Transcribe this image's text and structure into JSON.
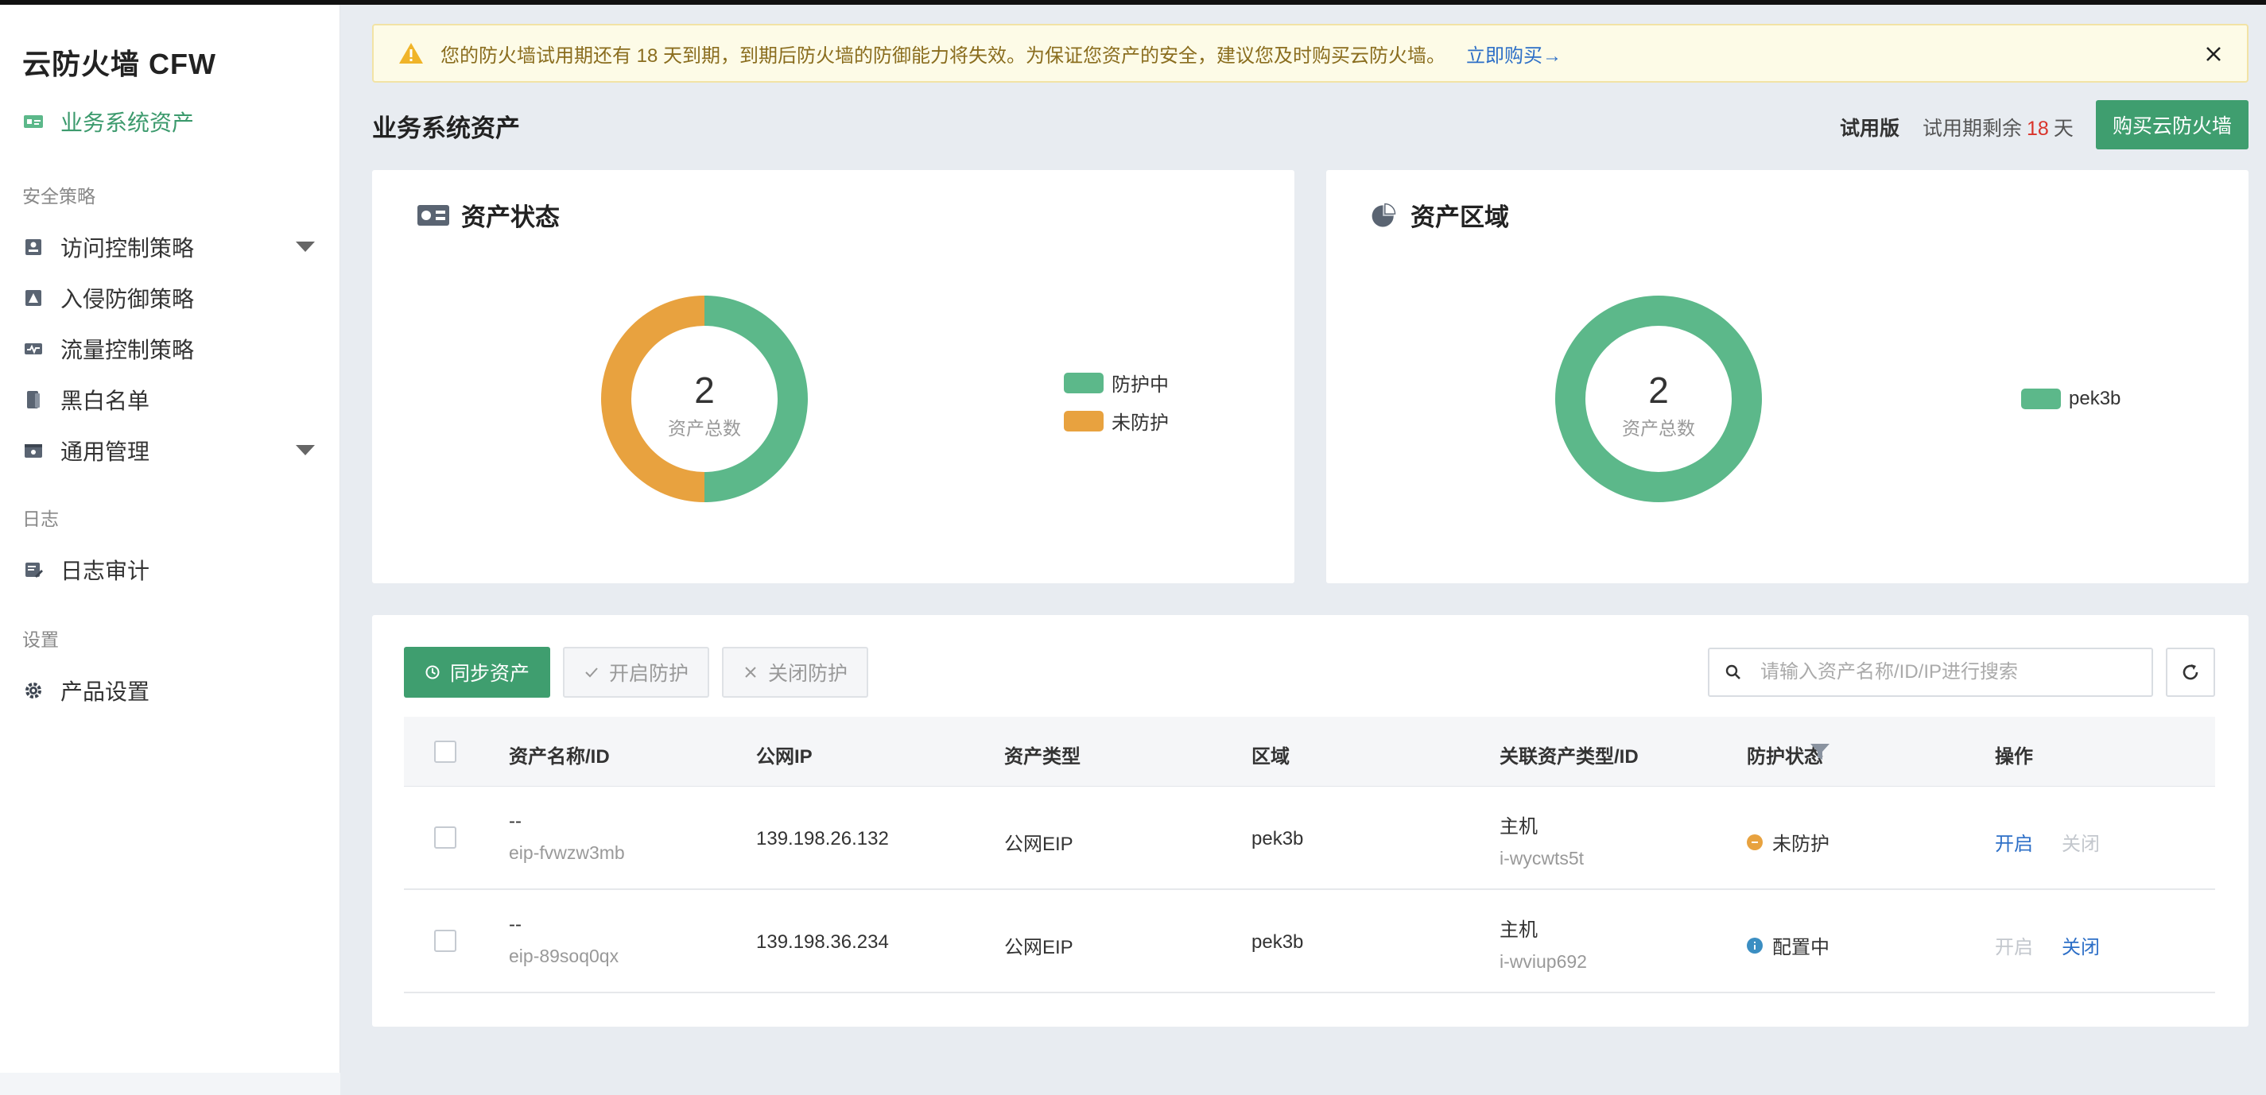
{
  "app": {
    "brand": "云防火墙 CFW"
  },
  "sidebar": {
    "active_item": "业务系统资产",
    "groups": [
      {
        "label": "安全策略"
      },
      {
        "label": "日志"
      },
      {
        "label": "设置"
      }
    ],
    "items": [
      {
        "label": "访问控制策略",
        "icon": "access-control-icon",
        "has_caret": true
      },
      {
        "label": "入侵防御策略",
        "icon": "intrusion-icon",
        "has_caret": false
      },
      {
        "label": "流量控制策略",
        "icon": "traffic-icon",
        "has_caret": false
      },
      {
        "label": "黑白名单",
        "icon": "list-icon",
        "has_caret": false
      },
      {
        "label": "通用管理",
        "icon": "manage-icon",
        "has_caret": true
      },
      {
        "label": "日志审计",
        "icon": "audit-icon",
        "has_caret": false
      },
      {
        "label": "产品设置",
        "icon": "gear-icon",
        "has_caret": false
      }
    ]
  },
  "alert": {
    "message": "您的防火墙试用期还有 18 天到期，到期后防火墙的防御能力将失效。为保证您资产的安全，建议您及时购买云防火墙。",
    "link": "立即购买→"
  },
  "header": {
    "title": "业务系统资产",
    "trial_tag": "试用版",
    "trial_prefix": "试用期剩余",
    "trial_days": "18",
    "trial_suffix": "天",
    "buy_button": "购买云防火墙"
  },
  "cards": {
    "status": {
      "title": "资产状态",
      "total": "2",
      "total_label": "资产总数",
      "legend": [
        {
          "name": "防护中",
          "value": 1,
          "color": "#5cb88a"
        },
        {
          "name": "未防护",
          "value": 1,
          "color": "#e8a23f"
        }
      ]
    },
    "region": {
      "title": "资产区域",
      "total": "2",
      "total_label": "资产总数",
      "legend": [
        {
          "name": "pek3b",
          "value": 2,
          "color": "#5cb88a"
        }
      ]
    }
  },
  "toolbar": {
    "sync_button": "同步资产",
    "enable_button": "开启防护",
    "disable_button": "关闭防护",
    "search_placeholder": "请输入资产名称/ID/IP进行搜索"
  },
  "table": {
    "columns": [
      "资产名称/ID",
      "公网IP",
      "资产类型",
      "区域",
      "关联资产类型/ID",
      "防护状态",
      "操作"
    ],
    "rows": [
      {
        "name": "--",
        "id": "eip-fvwzw3mb",
        "ip": "139.198.26.132",
        "type": "公网EIP",
        "region": "pek3b",
        "assoc_type": "主机",
        "assoc_id": "i-wycwts5t",
        "status": "未防护",
        "status_color": "#e8a23f",
        "op_on": "开启",
        "op_off": "关闭",
        "on_enabled": true,
        "off_enabled": false
      },
      {
        "name": "--",
        "id": "eip-89soq0qx",
        "ip": "139.198.36.234",
        "type": "公网EIP",
        "region": "pek3b",
        "assoc_type": "主机",
        "assoc_id": "i-wviup692",
        "status": "配置中",
        "status_color": "#3b8ec2",
        "op_on": "开启",
        "op_off": "关闭",
        "on_enabled": false,
        "off_enabled": true
      }
    ]
  }
}
